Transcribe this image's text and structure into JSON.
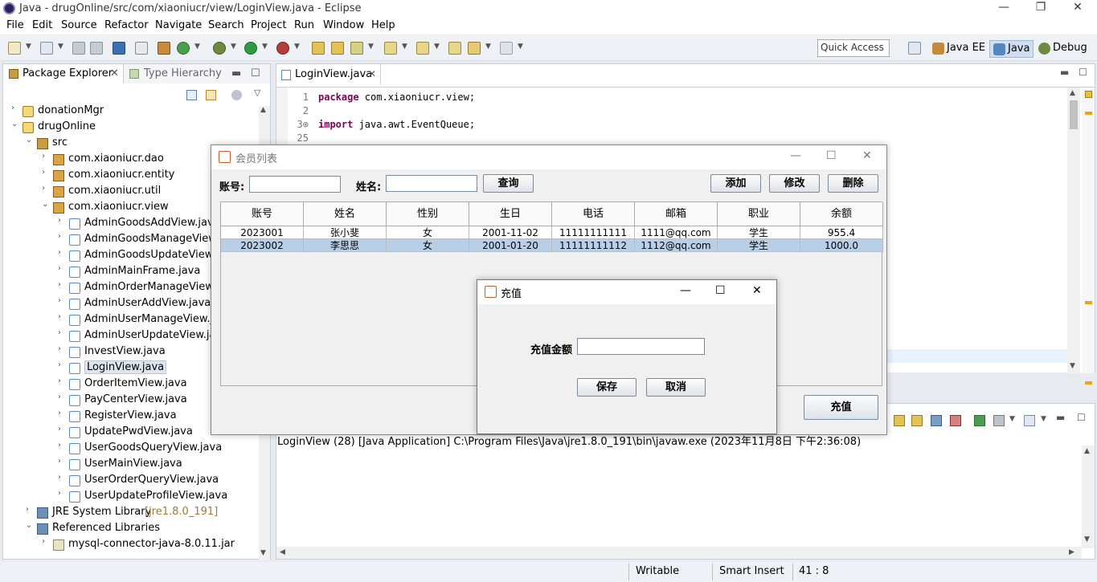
{
  "window": {
    "title": "Java - drugOnline/src/com/xiaoniucr/view/LoginView.java - Eclipse",
    "controls": {
      "minimize": "—",
      "restore": "❐",
      "close": "✕"
    }
  },
  "menu": [
    "File",
    "Edit",
    "Source",
    "Refactor",
    "Navigate",
    "Search",
    "Project",
    "Run",
    "Window",
    "Help"
  ],
  "toolbar": {
    "quick_access": "Quick Access",
    "perspectives": [
      "Java EE",
      "Java",
      "Debug"
    ]
  },
  "left_panel": {
    "tabs": [
      "Package Explorer",
      "Type Hierarchy"
    ],
    "tree": [
      {
        "label": "donationMgr",
        "arrow": "›",
        "icon": "proj",
        "indent": 0
      },
      {
        "label": "drugOnline",
        "arrow": "⌄",
        "icon": "proj",
        "indent": 0
      },
      {
        "label": "src",
        "arrow": "⌄",
        "icon": "src",
        "indent": 1
      },
      {
        "label": "com.xiaoniucr.dao",
        "arrow": "›",
        "icon": "pkg",
        "indent": 2
      },
      {
        "label": "com.xiaoniucr.entity",
        "arrow": "›",
        "icon": "pkg",
        "indent": 2
      },
      {
        "label": "com.xiaoniucr.util",
        "arrow": "›",
        "icon": "pkg",
        "indent": 2
      },
      {
        "label": "com.xiaoniucr.view",
        "arrow": "⌄",
        "icon": "pkg",
        "indent": 2
      },
      {
        "label": "AdminGoodsAddView.java",
        "arrow": "›",
        "icon": "java",
        "indent": 3
      },
      {
        "label": "AdminGoodsManageView.java",
        "arrow": "›",
        "icon": "java",
        "indent": 3
      },
      {
        "label": "AdminGoodsUpdateView.java",
        "arrow": "›",
        "icon": "java",
        "indent": 3
      },
      {
        "label": "AdminMainFrame.java",
        "arrow": "›",
        "icon": "java",
        "indent": 3
      },
      {
        "label": "AdminOrderManageView.java",
        "arrow": "›",
        "icon": "java",
        "indent": 3
      },
      {
        "label": "AdminUserAddView.java",
        "arrow": "›",
        "icon": "java",
        "indent": 3
      },
      {
        "label": "AdminUserManageView.java",
        "arrow": "›",
        "icon": "java",
        "indent": 3
      },
      {
        "label": "AdminUserUpdateView.java",
        "arrow": "›",
        "icon": "java",
        "indent": 3
      },
      {
        "label": "InvestView.java",
        "arrow": "›",
        "icon": "java",
        "indent": 3
      },
      {
        "label": "LoginView.java",
        "arrow": "›",
        "icon": "java",
        "indent": 3,
        "selected": true
      },
      {
        "label": "OrderItemView.java",
        "arrow": "›",
        "icon": "java",
        "indent": 3
      },
      {
        "label": "PayCenterView.java",
        "arrow": "›",
        "icon": "java",
        "indent": 3
      },
      {
        "label": "RegisterView.java",
        "arrow": "›",
        "icon": "java",
        "indent": 3
      },
      {
        "label": "UpdatePwdView.java",
        "arrow": "›",
        "icon": "java",
        "indent": 3
      },
      {
        "label": "UserGoodsQueryView.java",
        "arrow": "›",
        "icon": "java",
        "indent": 3
      },
      {
        "label": "UserMainView.java",
        "arrow": "›",
        "icon": "java",
        "indent": 3
      },
      {
        "label": "UserOrderQueryView.java",
        "arrow": "›",
        "icon": "java",
        "indent": 3
      },
      {
        "label": "UserUpdateProfileView.java",
        "arrow": "›",
        "icon": "java",
        "indent": 3
      },
      {
        "label": "JRE System Library",
        "suffix": "[jre1.8.0_191]",
        "arrow": "›",
        "icon": "lib",
        "indent": 1
      },
      {
        "label": "Referenced Libraries",
        "arrow": "⌄",
        "icon": "lib",
        "indent": 1
      },
      {
        "label": "mysql-connector-java-8.0.11.jar",
        "arrow": "›",
        "icon": "jar",
        "indent": 2
      }
    ]
  },
  "editor": {
    "tab": "LoginView.java",
    "lines": [
      {
        "no": "1",
        "kw": "package",
        "rest": " com.xiaoniucr.view;"
      },
      {
        "no": "2",
        "kw": "",
        "rest": ""
      },
      {
        "no": "3⊕",
        "kw": "import",
        "rest": " java.awt.EventQueue;"
      },
      {
        "no": "25",
        "kw": "",
        "rest": ""
      }
    ]
  },
  "console": {
    "text": "LoginView (28) [Java Application] C:\\Program Files\\Java\\jre1.8.0_191\\bin\\javaw.exe (2023年11月8日 下午2:36:08)"
  },
  "statusbar": {
    "writable": "Writable",
    "insert": "Smart Insert",
    "pos": "41 : 8"
  },
  "member_window": {
    "title": "会员列表",
    "account_label": "账号:",
    "name_label": "姓名:",
    "query": "查询",
    "add": "添加",
    "edit": "修改",
    "delete": "删除",
    "recharge": "充值",
    "columns": [
      "账号",
      "姓名",
      "性别",
      "生日",
      "电话",
      "邮箱",
      "职业",
      "余额"
    ],
    "rows": [
      [
        "2023001",
        "张小斐",
        "女",
        "2001-11-02",
        "11111111111",
        "1111@qq.com",
        "学生",
        "955.4"
      ],
      [
        "2023002",
        "李思思",
        "女",
        "2001-01-20",
        "11111111112",
        "1112@qq.com",
        "学生",
        "1000.0"
      ]
    ]
  },
  "recharge_dialog": {
    "title": "充值",
    "amount_label": "充值金额",
    "save": "保存",
    "cancel": "取消"
  }
}
